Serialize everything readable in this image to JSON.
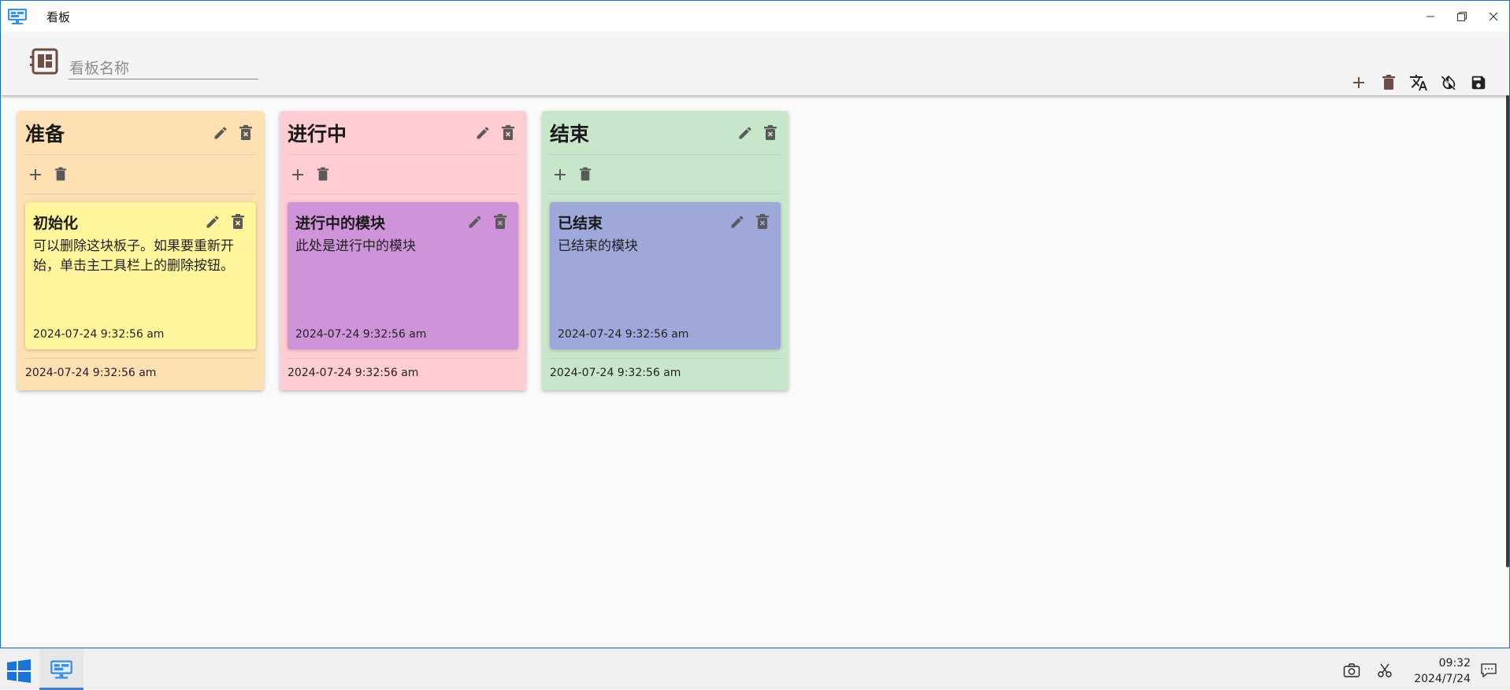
{
  "window": {
    "title": "看板"
  },
  "toolbar": {
    "board_name_placeholder": "看板名称",
    "actions": [
      "add-icon",
      "delete-icon",
      "translate-icon",
      "theme-off-icon",
      "save-icon"
    ]
  },
  "lists": [
    {
      "title": "准备",
      "color": "#ffe0b2",
      "footer_time": "2024-07-24 9:32:56 am",
      "card": {
        "title": "初始化",
        "body": "可以删除这块板子。如果要重新开始，单击主工具栏上的删除按钮。",
        "time": "2024-07-24 9:32:56 am",
        "color": "#fff59d"
      }
    },
    {
      "title": "进行中",
      "color": "#ffcdd2",
      "footer_time": "2024-07-24 9:32:56 am",
      "card": {
        "title": "进行中的模块",
        "body": "此处是进行中的模块",
        "time": "2024-07-24 9:32:56 am",
        "color": "#ce93d8"
      }
    },
    {
      "title": "结束",
      "color": "#c8e6c9",
      "footer_time": "2024-07-24 9:32:56 am",
      "card": {
        "title": "已结束",
        "body": "已结束的模块",
        "time": "2024-07-24 9:32:56 am",
        "color": "#9fa8da"
      }
    }
  ],
  "taskbar": {
    "time": "09:32",
    "date": "2024/7/24"
  }
}
